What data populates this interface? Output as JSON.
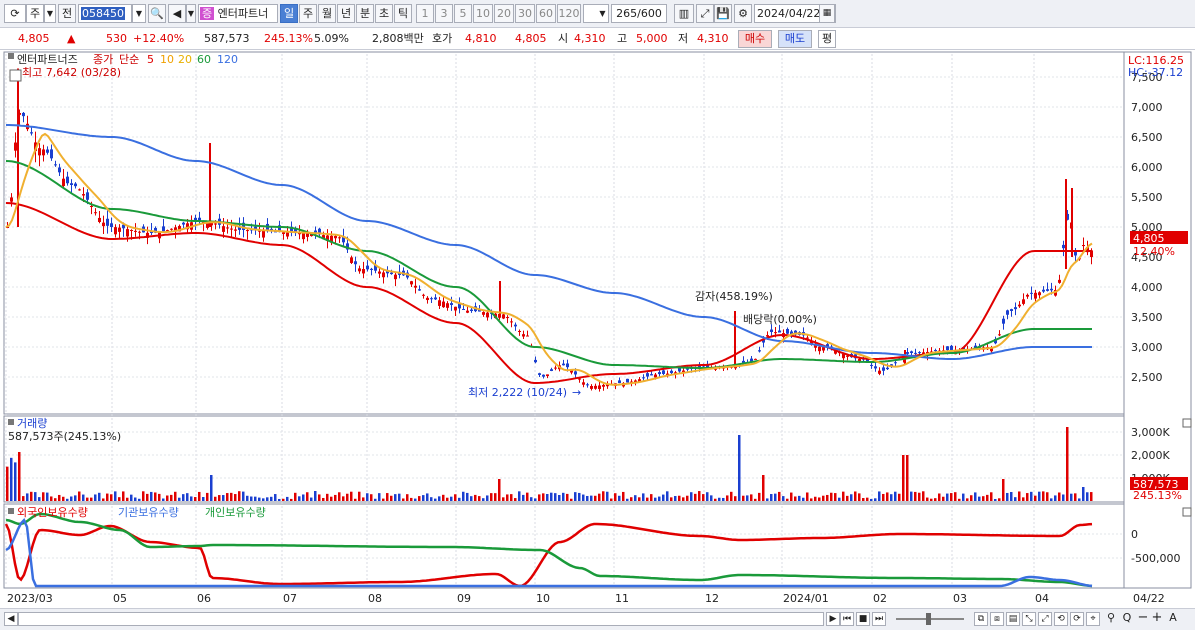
{
  "toolbar": {
    "market": "주",
    "prev_label": "전",
    "code": "058450",
    "stock_badge": "증",
    "stock_name": "엔터파트너",
    "periods": [
      "일",
      "주",
      "월",
      "년",
      "분",
      "초",
      "틱"
    ],
    "active_period": "일",
    "intervals": [
      "1",
      "3",
      "5",
      "10",
      "20",
      "30",
      "60",
      "120"
    ],
    "count": "265",
    "total": "/600",
    "date": "2024/04/22"
  },
  "quote": {
    "price": "4,805",
    "change_arrow": "▲",
    "change": "530",
    "change_pct": "+12.40%",
    "volume": "587,573",
    "volume_ratio": "245.13%",
    "turnover": "5.09%",
    "amount": "2,808백만",
    "ask_label": "호가",
    "ask1": "4,810",
    "ask2": "4,805",
    "open_label": "시",
    "open": "4,310",
    "high_label": "고",
    "high": "5,000",
    "low_label": "저",
    "low": "4,310",
    "buy": "매수",
    "sell": "매도",
    "avg": "평"
  },
  "price_panel": {
    "name": "엔터파트너즈",
    "legend": {
      "close": "종가",
      "method": "단순",
      "periods": [
        "5",
        "10",
        "20",
        "60",
        "120"
      ]
    },
    "high_marker": "최고 7,642 (03/28)",
    "low_marker": "최저 2,222 (10/24)",
    "event1": "감자(458.19%)",
    "event2": "배당락(0.00%)",
    "lc": "LC:116.25",
    "hc": "HC:-37.12",
    "y_ticks": [
      "7,500",
      "7,000",
      "6,500",
      "6,000",
      "5,500",
      "5,000",
      "4,500",
      "4,000",
      "3,500",
      "3,000",
      "2,500"
    ],
    "current_price": "4,805",
    "current_pct": "12.40%"
  },
  "volume_panel": {
    "title": "거래량",
    "value": "587,573주(245.13%)",
    "y_ticks": [
      "3,000K",
      "2,000K",
      "1,000K"
    ],
    "current": "587,573",
    "current_pct": "245.13%"
  },
  "holdings_panel": {
    "series": [
      "외국인보유수량",
      "기관보유수량",
      "개인보유수량"
    ],
    "y_ticks": [
      "0",
      "-500,000"
    ]
  },
  "x_axis": [
    "2023/03",
    "05",
    "06",
    "07",
    "08",
    "09",
    "10",
    "11",
    "12",
    "2024/01",
    "02",
    "03",
    "04"
  ],
  "x_axis_end": "04/22",
  "colors": {
    "ma5": "#e00000",
    "ma10": "#f0a000",
    "ma20": "#f0b030",
    "ma60": "#1a9a3a",
    "ma120": "#3a6fe0",
    "up": "#e00000",
    "down": "#1a3fd0"
  },
  "chart_data": {
    "type": "line",
    "x": [
      "2023/03",
      "2023/05",
      "2023/06",
      "2023/07",
      "2023/08",
      "2023/09",
      "2023/10",
      "2023/11",
      "2023/12",
      "2024/01",
      "2024/02",
      "2024/03",
      "2024/04"
    ],
    "ylim": [
      2200,
      7700
    ],
    "series": [
      {
        "name": "5",
        "values": [
          5400,
          4800,
          4900,
          4700,
          4000,
          3400,
          2400,
          2550,
          2700,
          3200,
          2800,
          2900,
          4600
        ]
      },
      {
        "name": "60",
        "values": [
          6100,
          5300,
          5100,
          5000,
          4600,
          4000,
          3000,
          2700,
          2650,
          2800,
          2750,
          2900,
          3300
        ]
      },
      {
        "name": "120",
        "values": [
          6700,
          6500,
          6100,
          5700,
          5100,
          4700,
          4200,
          3900,
          3500,
          3100,
          2900,
          2800,
          3000
        ]
      }
    ]
  }
}
